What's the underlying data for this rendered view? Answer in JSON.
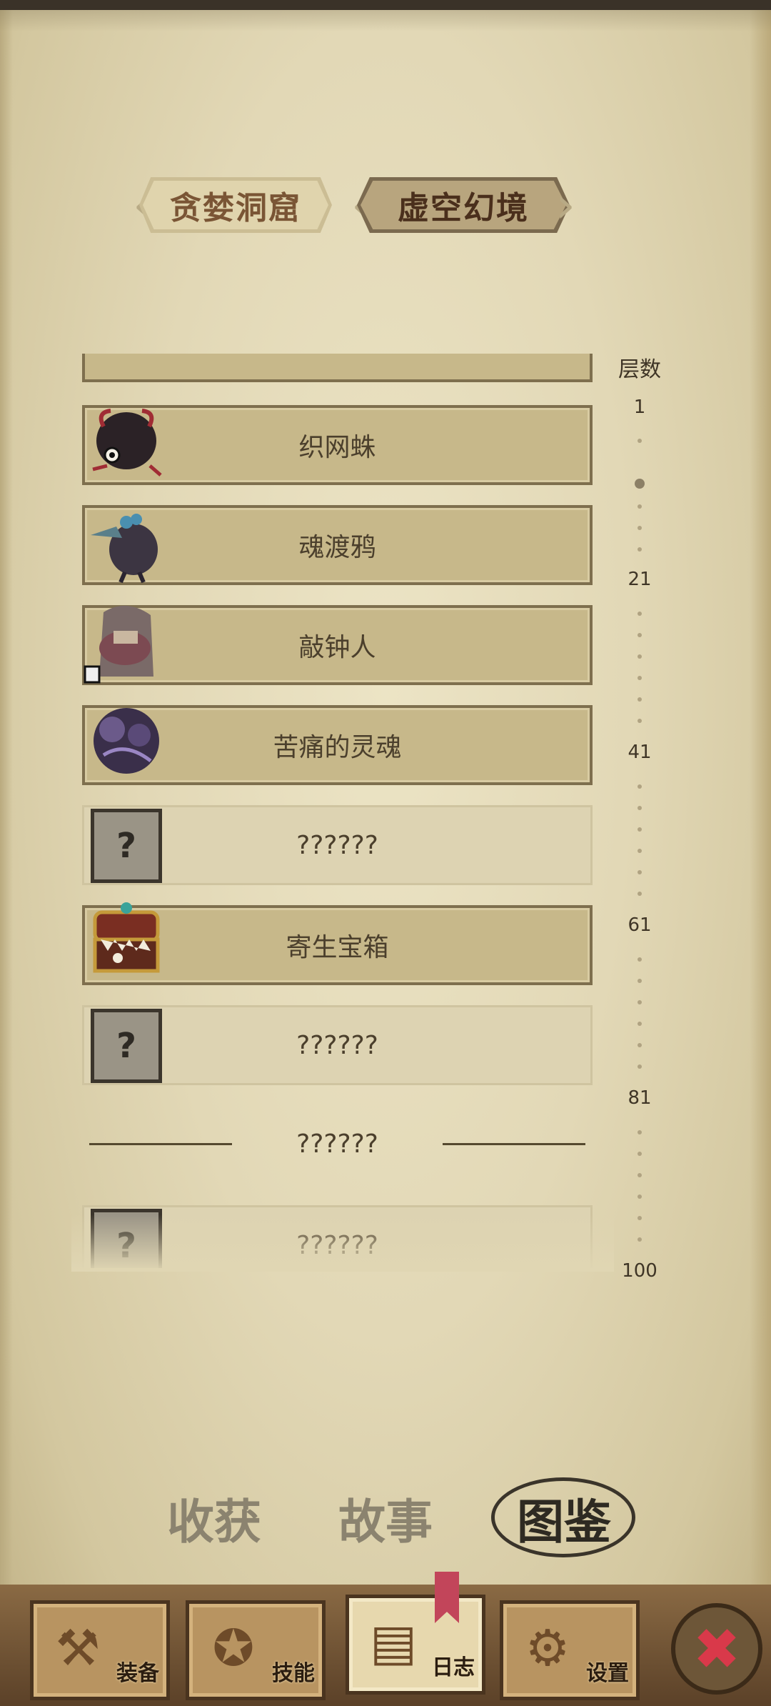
{
  "world_tabs": [
    {
      "label": "贪婪洞窟",
      "active": false
    },
    {
      "label": "虚空幻境",
      "active": true
    }
  ],
  "monster_list": [
    {
      "name": "织网蛛",
      "unlocked": true,
      "icon": "spider-icon"
    },
    {
      "name": "魂渡鸦",
      "unlocked": true,
      "icon": "raven-icon"
    },
    {
      "name": "敲钟人",
      "unlocked": true,
      "icon": "bell-ringer-icon"
    },
    {
      "name": "苦痛的灵魂",
      "unlocked": true,
      "icon": "tormented-soul-icon"
    },
    {
      "name": "??????",
      "unlocked": false,
      "icon": "question-mark-icon"
    },
    {
      "name": "寄生宝箱",
      "unlocked": true,
      "icon": "parasitic-chest-icon"
    },
    {
      "name": "??????",
      "unlocked": false,
      "icon": "question-mark-icon"
    }
  ],
  "section_divider": "??????",
  "extra_locked_entry": "??????",
  "locked_icon_glyph": "?",
  "floor_scale": {
    "title": "层数",
    "marks": [
      "1",
      "21",
      "41",
      "61",
      "81",
      "100"
    ]
  },
  "sub_tabs": [
    {
      "label": "收获",
      "active": false
    },
    {
      "label": "故事",
      "active": false
    },
    {
      "label": "图鉴",
      "active": true
    }
  ],
  "bottom_nav": [
    {
      "label": "装备",
      "icon": "axe-icon",
      "active": false
    },
    {
      "label": "技能",
      "icon": "skill-icon",
      "active": false
    },
    {
      "label": "日志",
      "icon": "journal-icon",
      "active": true
    },
    {
      "label": "设置",
      "icon": "gear-icon",
      "active": false
    }
  ],
  "close_glyph": "✖",
  "colors": {
    "parchment": "#e2d8b6",
    "card_unlocked": "#c7b88a",
    "card_locked": "#ddd3b2",
    "close_red": "#d9394a"
  }
}
